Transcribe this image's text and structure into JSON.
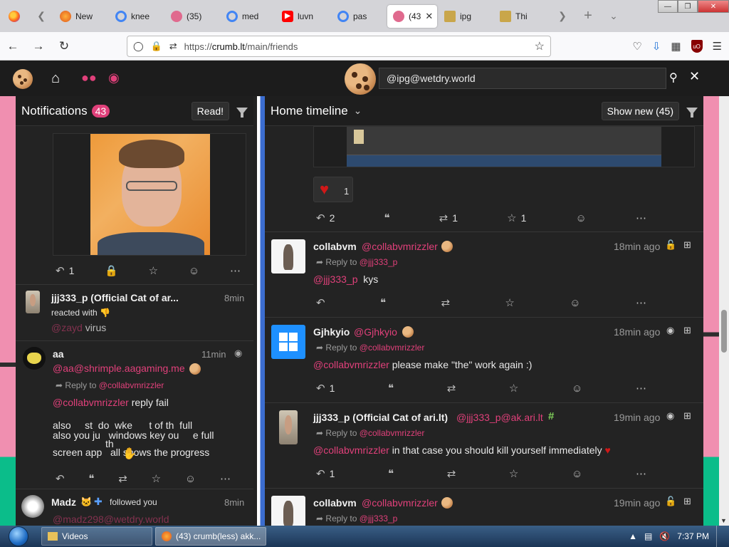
{
  "browser": {
    "tabs": [
      {
        "title": "New",
        "icon": "firefox-icon"
      },
      {
        "title": "knee",
        "icon": "google-icon"
      },
      {
        "title": "(35)",
        "icon": "crumb-icon"
      },
      {
        "title": "med",
        "icon": "google-icon"
      },
      {
        "title": "luvn",
        "icon": "youtube-icon"
      },
      {
        "title": "pas",
        "icon": "google-icon"
      },
      {
        "title": "(43",
        "icon": "crumb-icon",
        "active": true
      },
      {
        "title": "ipg",
        "icon": "folder-icon"
      },
      {
        "title": "Thi",
        "icon": "folder-icon"
      }
    ],
    "url_prefix": "https://",
    "url_host": "crumb.lt",
    "url_path": "/main/friends"
  },
  "app": {
    "search_value": "@ipg@wetdry.world",
    "accent": "#e0407a"
  },
  "notifications": {
    "title": "Notifications",
    "count": "43",
    "read_button": "Read!",
    "top_actions": {
      "reply_count": "1"
    },
    "items": [
      {
        "name": "jjj333_p (Official Cat of ar...",
        "time": "8min",
        "line": "reacted with",
        "mention": "@zayd",
        "text": "virus"
      },
      {
        "name": "aa",
        "time": "11min",
        "handle": "@aa@shrimple.aagaming.me",
        "reply_to_label": "Reply to",
        "reply_to": "@collabvmrizzler",
        "mention": "@collabvmrizzler",
        "text": "reply fail",
        "garbled_line1": "also     st  do  wke      t of th  full",
        "garbled_line2": "also you ju   windows key ou     e full",
        "garbled_line3": "screen app   all shows the progress",
        "garbled_th": "th"
      },
      {
        "name": "Madz",
        "action": "followed you",
        "time": "8min",
        "handle": "@madz298@wetdry.world"
      }
    ]
  },
  "timeline": {
    "title": "Home timeline",
    "show_new": "Show new (45)",
    "top_post": {
      "likes": "1",
      "replies": "2",
      "boosts": "1",
      "favs": "1"
    },
    "posts": [
      {
        "name": "collabvm",
        "handle": "@collabvmrizzler",
        "time": "18min ago",
        "reply_to_label": "Reply to",
        "reply_to": "@jjj333_p",
        "mention": "@jjj333_p",
        "text": "kys"
      },
      {
        "name": "Gjhkyio",
        "handle": "@Gjhkyio",
        "time": "18min ago",
        "reply_to_label": "Reply to",
        "reply_to": "@collabvmrizzler",
        "mention": "@collabvmrizzler",
        "text": "please make \"the\" work again :)",
        "replies": "1"
      },
      {
        "name": "jjj333_p (Official Cat of ari.lt)",
        "handle": "@jjj333_p@ak.ari.lt",
        "time": "19min ago",
        "reply_to_label": "Reply to",
        "reply_to": "@collabvmrizzler",
        "mention": "@collabvmrizzler",
        "text": "in that case you should kill yourself immediately",
        "replies": "1"
      },
      {
        "name": "collabvm",
        "handle": "@collabvmrizzler",
        "time": "19min ago",
        "reply_to_label": "Reply to",
        "reply_to": "@jjj333_p"
      }
    ]
  },
  "taskbar": {
    "items": [
      "Videos",
      "(43) crumb(less) akk..."
    ],
    "clock": "7:37 PM"
  }
}
